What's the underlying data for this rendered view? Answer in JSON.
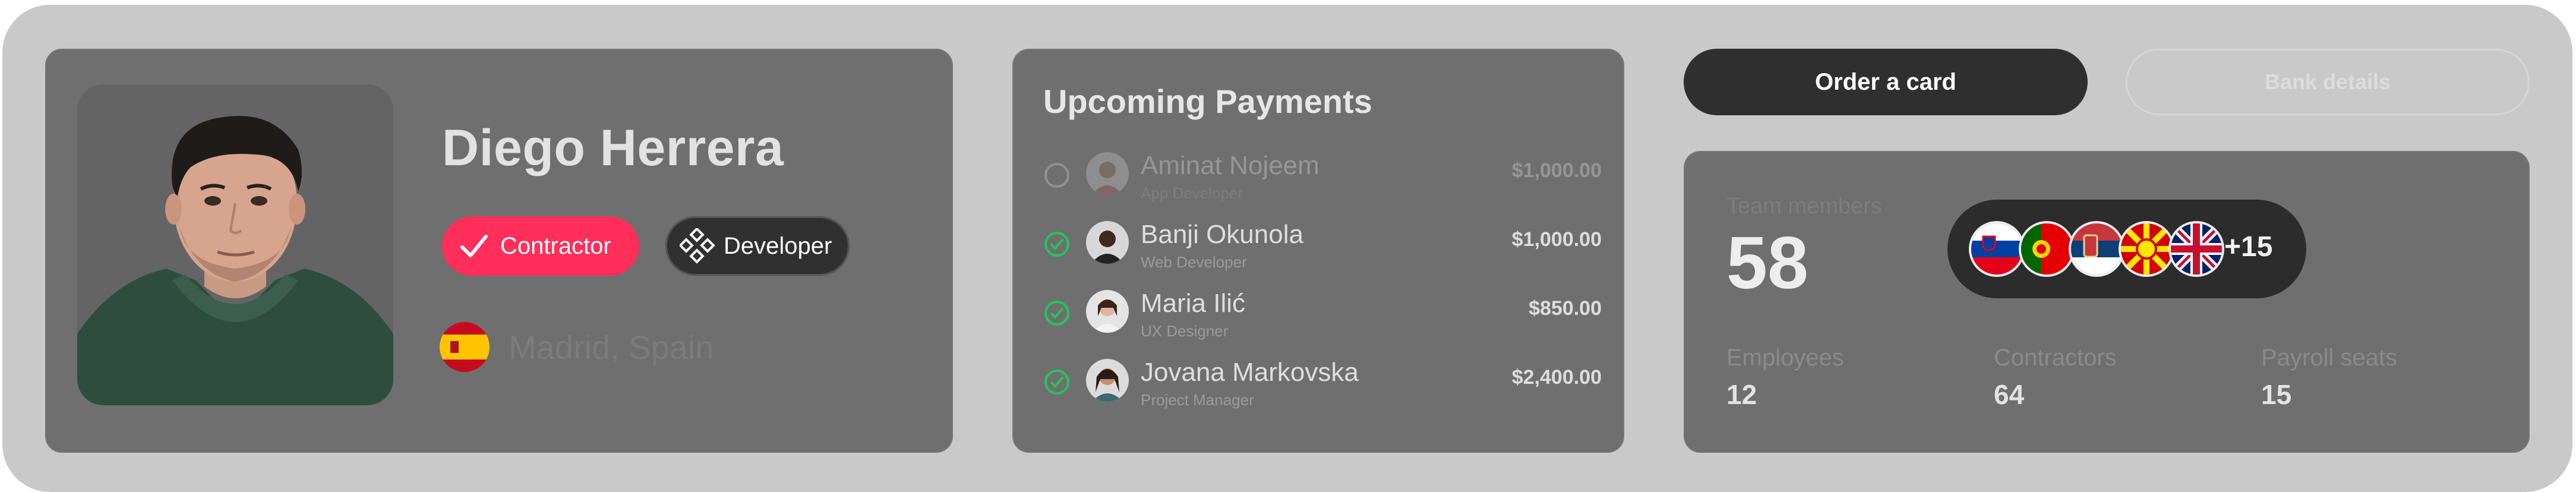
{
  "profile": {
    "name": "Diego Herrera",
    "badges": {
      "contractor": "Contractor",
      "developer": "Developer"
    },
    "location": "Madrid, Spain",
    "colors": {
      "contractor_badge": "#ff2e5b"
    }
  },
  "payments": {
    "title": "Upcoming Payments",
    "rows": [
      {
        "name": "Aminat Nojeem",
        "role": "App Developer",
        "amount": "$1,000.00",
        "status": "unchecked"
      },
      {
        "name": "Banji Okunola",
        "role": "Web Developer",
        "amount": "$1,000.00",
        "status": "checked"
      },
      {
        "name": "Maria Ilić",
        "role": "UX Designer",
        "amount": "$850.00",
        "status": "checked"
      },
      {
        "name": "Jovana Markovska",
        "role": "Project Manager",
        "amount": "$2,400.00",
        "status": "checked"
      }
    ],
    "colors": {
      "check": "#22c55e"
    }
  },
  "actions": {
    "order_card": "Order a card",
    "bank_details": "Bank details"
  },
  "team": {
    "label": "Team members",
    "count": "58",
    "flags": [
      "slovenia",
      "portugal",
      "serbia",
      "north-macedonia",
      "united-kingdom"
    ],
    "more": "+15",
    "stats": [
      {
        "label": "Employees",
        "value": "12"
      },
      {
        "label": "Contractors",
        "value": "64"
      },
      {
        "label": "Payroll seats",
        "value": "15"
      }
    ]
  }
}
